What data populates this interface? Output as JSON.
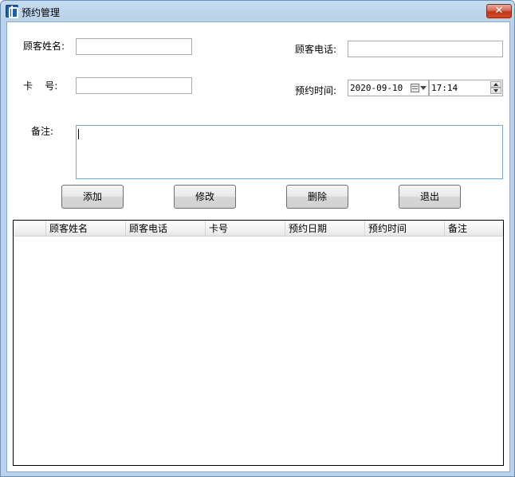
{
  "window": {
    "title": "预约管理",
    "close_glyph": "✕"
  },
  "form": {
    "name_label": "顾客姓名:",
    "name_value": "",
    "phone_label": "顾客电话:",
    "phone_value": "",
    "card_label": "卡    号:",
    "card_value": "",
    "time_label": "预约时间:",
    "date_value": "2020-09-10",
    "time_value": "17:14",
    "remark_label": "备注:",
    "remark_value": ""
  },
  "buttons": {
    "add": "添加",
    "edit": "修改",
    "delete": "删除",
    "exit": "退出"
  },
  "grid": {
    "columns": [
      "顾客姓名",
      "顾客电话",
      "卡号",
      "预约日期",
      "预约时间",
      "备注"
    ],
    "rows": []
  },
  "icons": {
    "app": "app-icon",
    "calendar": "calendar-icon"
  },
  "colors": {
    "titlebar": "#b9d1ea",
    "close": "#c2351a"
  }
}
